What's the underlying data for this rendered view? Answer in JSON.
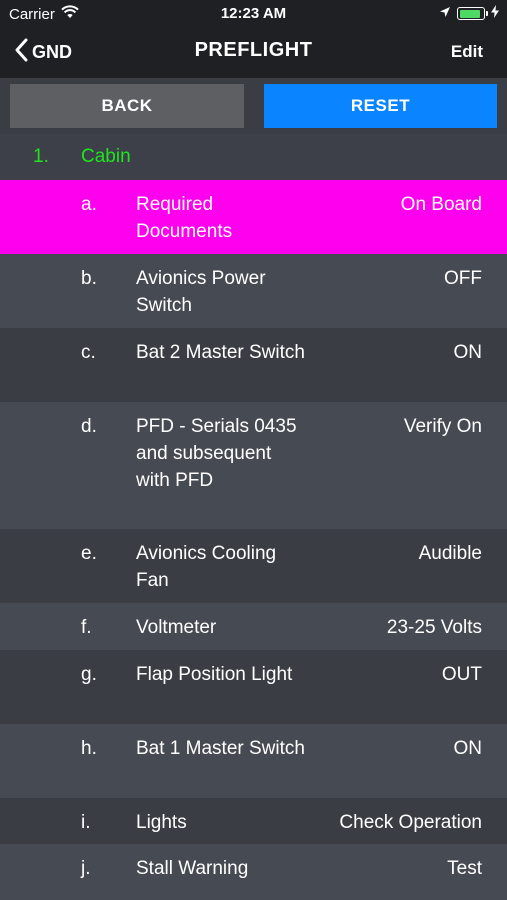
{
  "status_bar": {
    "carrier": "Carrier",
    "time": "12:23 AM",
    "battery_level": 0.9
  },
  "nav": {
    "back_label": "GND",
    "title": "PREFLIGHT",
    "edit_label": "Edit"
  },
  "buttons": {
    "back_label": "BACK",
    "reset_label": "RESET"
  },
  "section": {
    "number": "1.",
    "title": "Cabin"
  },
  "colors": {
    "selected_row": "#ff00ee",
    "section_text": "#1ee51e",
    "reset_button": "#0a84ff"
  },
  "rows": [
    {
      "letter": "a.",
      "item": "Required Documents",
      "value": "On Board",
      "selected": true
    },
    {
      "letter": "b.",
      "item": "Avionics Power Switch",
      "value": "OFF"
    },
    {
      "letter": "c.",
      "item": "Bat 2 Master Switch",
      "value": "ON"
    },
    {
      "letter": "d.",
      "item": "PFD - Serials 0435 and subsequent with PFD",
      "value": "Verify On"
    },
    {
      "letter": "e.",
      "item": "Avionics Cooling Fan",
      "value": "Audible"
    },
    {
      "letter": "f.",
      "item": "Voltmeter",
      "value": "23-25 Volts"
    },
    {
      "letter": "g.",
      "item": "Flap Position Light",
      "value": "OUT"
    },
    {
      "letter": "h.",
      "item": "Bat 1 Master Switch",
      "value": "ON"
    },
    {
      "letter": "i.",
      "item": "Lights",
      "value": "Check Operation"
    },
    {
      "letter": "j.",
      "item": "Stall Warning",
      "value": "Test"
    }
  ]
}
